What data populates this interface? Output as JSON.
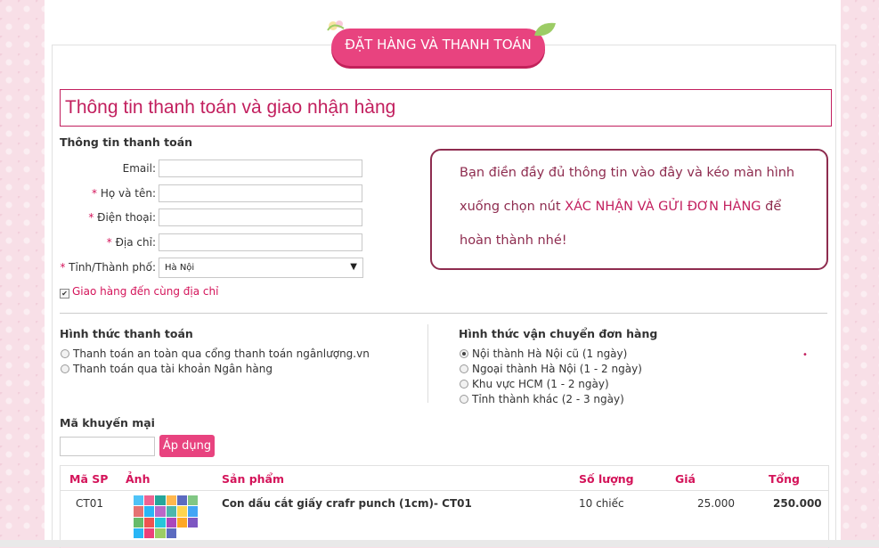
{
  "banner": {
    "title": "ĐẶT HÀNG VÀ THANH TOÁN"
  },
  "section_title": "Thông tin thanh toán và giao nhận hàng",
  "billing": {
    "heading": "Thông tin thanh toán",
    "fields": [
      {
        "label": "Email:",
        "required": false,
        "value": ""
      },
      {
        "label": "Họ và tên:",
        "required": true,
        "value": ""
      },
      {
        "label": "Điện thoại:",
        "required": true,
        "value": ""
      },
      {
        "label": "Địa chỉ:",
        "required": true,
        "value": ""
      }
    ],
    "city": {
      "label": "Tỉnh/Thành phố:",
      "value": "Hà Nội"
    },
    "same_address": {
      "label": "Giao hàng đến cùng địa chỉ",
      "checked": true
    }
  },
  "notice": {
    "line1": "Bạn điền đầy đủ thông tin vào đây và kéo màn hình",
    "line2_pre": "xuống chọn nút ",
    "line2_highlight": "XÁC NHẬN VÀ GỬI ĐƠN HÀNG",
    "line2_post": " để",
    "line3": "hoàn thành nhé!"
  },
  "payment": {
    "heading": "Hình thức thanh toán",
    "options": [
      {
        "label": "Thanh toán an toàn qua cổng thanh toán ngânlượng.vn",
        "selected": false
      },
      {
        "label": "Thanh toán qua tài khoản Ngân hàng",
        "selected": false
      }
    ]
  },
  "shipping": {
    "heading": "Hình thức vận chuyển đơn hàng",
    "options": [
      {
        "label": "Nội thành Hà Nội cũ (1 ngày)",
        "selected": true
      },
      {
        "label": "Ngoại thành Hà Nội (1 - 2 ngày)",
        "selected": false
      },
      {
        "label": "Khu vực HCM (1 - 2 ngày)",
        "selected": false
      },
      {
        "label": "Tỉnh thành khác (2 - 3 ngày)",
        "selected": false
      }
    ]
  },
  "promo": {
    "heading": "Mã khuyến mại",
    "value": "",
    "button": "Áp dụng"
  },
  "table": {
    "headers": [
      "Mã SP",
      "Ảnh",
      "Sản phẩm",
      "Số lượng",
      "Giá",
      "Tổng"
    ],
    "rows": [
      {
        "code": "CT01",
        "product": "Con dấu cắt giấy crafr punch (1cm)- CT01",
        "qty": "10 chiếc",
        "price": "25.000",
        "total": "250.000"
      }
    ]
  },
  "colors": {
    "brand": "#e8437f",
    "title": "#c21f5e",
    "notice_border": "#8e2c4f"
  },
  "icons": {
    "search": "magnifier-icon",
    "checkbox": "checkbox-icon",
    "select": "dropdown-arrow-icon"
  }
}
